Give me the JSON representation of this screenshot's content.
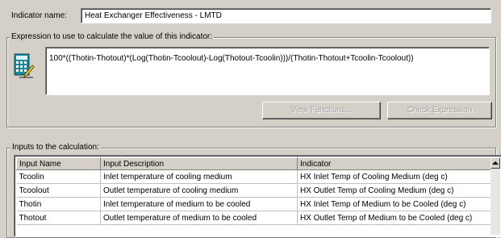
{
  "indicator": {
    "name_label": "Indicator name:",
    "name_value": "Heat Exchanger Effectiveness - LMTD"
  },
  "expression": {
    "group_label": "Expression to use to calculate the value of this indicator:",
    "value": "100*((Thotin-Thotout)*(Log(Thotin-Tcoolout)-Log(Thotout-Tcoolin)))/(Thotin-Thotout+Tcoolin-Tcoolout))",
    "icon": "calculator-edit-icon",
    "view_functions_label": "View Functions...",
    "check_expression_label": "Check Expression"
  },
  "inputs": {
    "group_label": "Inputs to the calculation:",
    "columns": [
      "Input Name",
      "Input Description",
      "Indicator"
    ],
    "rows": [
      [
        "Tcoolin",
        "Inlet temperature of cooling medium",
        "HX Inlet Temp of Cooling Medium (deg c)"
      ],
      [
        "Tcoolout",
        "Outlet temperature of cooling medium",
        "HX Outlet Temp of Cooling Medium (deg c)"
      ],
      [
        "Thotin",
        "Inlet temperature of medium to be cooled",
        "HX Inlet Temp of Medium to be Cooled (deg c)"
      ],
      [
        "Thotout",
        "Outlet temperature of medium to be cooled",
        "HX Outlet Temp of Medium to be Cooled (deg c)"
      ]
    ]
  }
}
